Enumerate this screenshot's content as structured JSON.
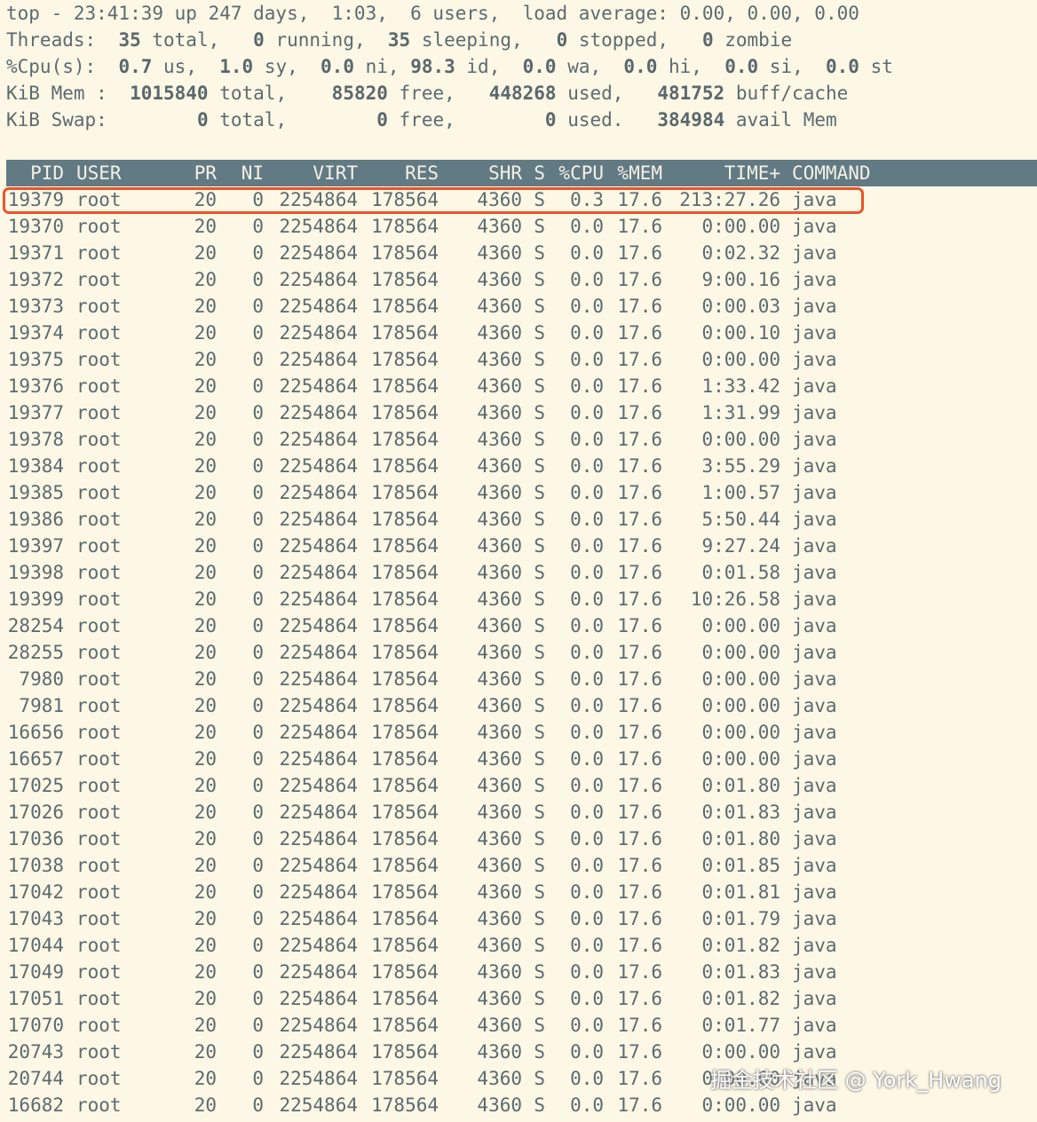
{
  "summary": {
    "line1": [
      {
        "t": "top - 23:41:39 up 247 days,  1:03,  6 users,  load average: 0.00, 0.00, 0.00",
        "b": false
      }
    ],
    "line2": [
      {
        "t": "Threads:  ",
        "b": false
      },
      {
        "t": "35",
        "b": true
      },
      {
        "t": " total,   ",
        "b": false
      },
      {
        "t": "0",
        "b": true
      },
      {
        "t": " running,  ",
        "b": false
      },
      {
        "t": "35",
        "b": true
      },
      {
        "t": " sleeping,   ",
        "b": false
      },
      {
        "t": "0",
        "b": true
      },
      {
        "t": " stopped,   ",
        "b": false
      },
      {
        "t": "0",
        "b": true
      },
      {
        "t": " zombie",
        "b": false
      }
    ],
    "line3": [
      {
        "t": "%Cpu(s):  ",
        "b": false
      },
      {
        "t": "0.7",
        "b": true
      },
      {
        "t": " us,  ",
        "b": false
      },
      {
        "t": "1.0",
        "b": true
      },
      {
        "t": " sy,  ",
        "b": false
      },
      {
        "t": "0.0",
        "b": true
      },
      {
        "t": " ni, ",
        "b": false
      },
      {
        "t": "98.3",
        "b": true
      },
      {
        "t": " id,  ",
        "b": false
      },
      {
        "t": "0.0",
        "b": true
      },
      {
        "t": " wa,  ",
        "b": false
      },
      {
        "t": "0.0",
        "b": true
      },
      {
        "t": " hi,  ",
        "b": false
      },
      {
        "t": "0.0",
        "b": true
      },
      {
        "t": " si,  ",
        "b": false
      },
      {
        "t": "0.0",
        "b": true
      },
      {
        "t": " st",
        "b": false
      }
    ],
    "line4": [
      {
        "t": "KiB Mem :  ",
        "b": false
      },
      {
        "t": "1015840",
        "b": true
      },
      {
        "t": " total,    ",
        "b": false
      },
      {
        "t": "85820",
        "b": true
      },
      {
        "t": " free,   ",
        "b": false
      },
      {
        "t": "448268",
        "b": true
      },
      {
        "t": " used,   ",
        "b": false
      },
      {
        "t": "481752",
        "b": true
      },
      {
        "t": " buff/cache",
        "b": false
      }
    ],
    "line5": [
      {
        "t": "KiB Swap:        ",
        "b": false
      },
      {
        "t": "0",
        "b": true
      },
      {
        "t": " total,        ",
        "b": false
      },
      {
        "t": "0",
        "b": true
      },
      {
        "t": " free,        ",
        "b": false
      },
      {
        "t": "0",
        "b": true
      },
      {
        "t": " used.   ",
        "b": false
      },
      {
        "t": "384984",
        "b": true
      },
      {
        "t": " avail Mem",
        "b": false
      }
    ]
  },
  "columns": [
    "PID",
    "USER",
    "PR",
    "NI",
    "VIRT",
    "RES",
    "SHR",
    "S",
    "%CPU",
    "%MEM",
    "TIME+",
    "COMMAND"
  ],
  "rows": [
    [
      "19379",
      "root",
      "20",
      "0",
      "2254864",
      "178564",
      "4360",
      "S",
      "0.3",
      "17.6",
      "213:27.26",
      "java"
    ],
    [
      "19370",
      "root",
      "20",
      "0",
      "2254864",
      "178564",
      "4360",
      "S",
      "0.0",
      "17.6",
      "0:00.00",
      "java"
    ],
    [
      "19371",
      "root",
      "20",
      "0",
      "2254864",
      "178564",
      "4360",
      "S",
      "0.0",
      "17.6",
      "0:02.32",
      "java"
    ],
    [
      "19372",
      "root",
      "20",
      "0",
      "2254864",
      "178564",
      "4360",
      "S",
      "0.0",
      "17.6",
      "9:00.16",
      "java"
    ],
    [
      "19373",
      "root",
      "20",
      "0",
      "2254864",
      "178564",
      "4360",
      "S",
      "0.0",
      "17.6",
      "0:00.03",
      "java"
    ],
    [
      "19374",
      "root",
      "20",
      "0",
      "2254864",
      "178564",
      "4360",
      "S",
      "0.0",
      "17.6",
      "0:00.10",
      "java"
    ],
    [
      "19375",
      "root",
      "20",
      "0",
      "2254864",
      "178564",
      "4360",
      "S",
      "0.0",
      "17.6",
      "0:00.00",
      "java"
    ],
    [
      "19376",
      "root",
      "20",
      "0",
      "2254864",
      "178564",
      "4360",
      "S",
      "0.0",
      "17.6",
      "1:33.42",
      "java"
    ],
    [
      "19377",
      "root",
      "20",
      "0",
      "2254864",
      "178564",
      "4360",
      "S",
      "0.0",
      "17.6",
      "1:31.99",
      "java"
    ],
    [
      "19378",
      "root",
      "20",
      "0",
      "2254864",
      "178564",
      "4360",
      "S",
      "0.0",
      "17.6",
      "0:00.00",
      "java"
    ],
    [
      "19384",
      "root",
      "20",
      "0",
      "2254864",
      "178564",
      "4360",
      "S",
      "0.0",
      "17.6",
      "3:55.29",
      "java"
    ],
    [
      "19385",
      "root",
      "20",
      "0",
      "2254864",
      "178564",
      "4360",
      "S",
      "0.0",
      "17.6",
      "1:00.57",
      "java"
    ],
    [
      "19386",
      "root",
      "20",
      "0",
      "2254864",
      "178564",
      "4360",
      "S",
      "0.0",
      "17.6",
      "5:50.44",
      "java"
    ],
    [
      "19397",
      "root",
      "20",
      "0",
      "2254864",
      "178564",
      "4360",
      "S",
      "0.0",
      "17.6",
      "9:27.24",
      "java"
    ],
    [
      "19398",
      "root",
      "20",
      "0",
      "2254864",
      "178564",
      "4360",
      "S",
      "0.0",
      "17.6",
      "0:01.58",
      "java"
    ],
    [
      "19399",
      "root",
      "20",
      "0",
      "2254864",
      "178564",
      "4360",
      "S",
      "0.0",
      "17.6",
      "10:26.58",
      "java"
    ],
    [
      "28254",
      "root",
      "20",
      "0",
      "2254864",
      "178564",
      "4360",
      "S",
      "0.0",
      "17.6",
      "0:00.00",
      "java"
    ],
    [
      "28255",
      "root",
      "20",
      "0",
      "2254864",
      "178564",
      "4360",
      "S",
      "0.0",
      "17.6",
      "0:00.00",
      "java"
    ],
    [
      "7980",
      "root",
      "20",
      "0",
      "2254864",
      "178564",
      "4360",
      "S",
      "0.0",
      "17.6",
      "0:00.00",
      "java"
    ],
    [
      "7981",
      "root",
      "20",
      "0",
      "2254864",
      "178564",
      "4360",
      "S",
      "0.0",
      "17.6",
      "0:00.00",
      "java"
    ],
    [
      "16656",
      "root",
      "20",
      "0",
      "2254864",
      "178564",
      "4360",
      "S",
      "0.0",
      "17.6",
      "0:00.00",
      "java"
    ],
    [
      "16657",
      "root",
      "20",
      "0",
      "2254864",
      "178564",
      "4360",
      "S",
      "0.0",
      "17.6",
      "0:00.00",
      "java"
    ],
    [
      "17025",
      "root",
      "20",
      "0",
      "2254864",
      "178564",
      "4360",
      "S",
      "0.0",
      "17.6",
      "0:01.80",
      "java"
    ],
    [
      "17026",
      "root",
      "20",
      "0",
      "2254864",
      "178564",
      "4360",
      "S",
      "0.0",
      "17.6",
      "0:01.83",
      "java"
    ],
    [
      "17036",
      "root",
      "20",
      "0",
      "2254864",
      "178564",
      "4360",
      "S",
      "0.0",
      "17.6",
      "0:01.80",
      "java"
    ],
    [
      "17038",
      "root",
      "20",
      "0",
      "2254864",
      "178564",
      "4360",
      "S",
      "0.0",
      "17.6",
      "0:01.85",
      "java"
    ],
    [
      "17042",
      "root",
      "20",
      "0",
      "2254864",
      "178564",
      "4360",
      "S",
      "0.0",
      "17.6",
      "0:01.81",
      "java"
    ],
    [
      "17043",
      "root",
      "20",
      "0",
      "2254864",
      "178564",
      "4360",
      "S",
      "0.0",
      "17.6",
      "0:01.79",
      "java"
    ],
    [
      "17044",
      "root",
      "20",
      "0",
      "2254864",
      "178564",
      "4360",
      "S",
      "0.0",
      "17.6",
      "0:01.82",
      "java"
    ],
    [
      "17049",
      "root",
      "20",
      "0",
      "2254864",
      "178564",
      "4360",
      "S",
      "0.0",
      "17.6",
      "0:01.83",
      "java"
    ],
    [
      "17051",
      "root",
      "20",
      "0",
      "2254864",
      "178564",
      "4360",
      "S",
      "0.0",
      "17.6",
      "0:01.82",
      "java"
    ],
    [
      "17070",
      "root",
      "20",
      "0",
      "2254864",
      "178564",
      "4360",
      "S",
      "0.0",
      "17.6",
      "0:01.77",
      "java"
    ],
    [
      "20743",
      "root",
      "20",
      "0",
      "2254864",
      "178564",
      "4360",
      "S",
      "0.0",
      "17.6",
      "0:00.00",
      "java"
    ],
    [
      "20744",
      "root",
      "20",
      "0",
      "2254864",
      "178564",
      "4360",
      "S",
      "0.0",
      "17.6",
      "0:00.00",
      "java"
    ],
    [
      "16682",
      "root",
      "20",
      "0",
      "2254864",
      "178564",
      "4360",
      "S",
      "0.0",
      "17.6",
      "0:00.00",
      "java"
    ]
  ],
  "highlighted_row": 0,
  "highlight_color": "#e8552a",
  "header_bg_color": "#627a83",
  "background_color": "#fdf7e5",
  "watermark": "掘金技术社区 @ York_Hwang"
}
